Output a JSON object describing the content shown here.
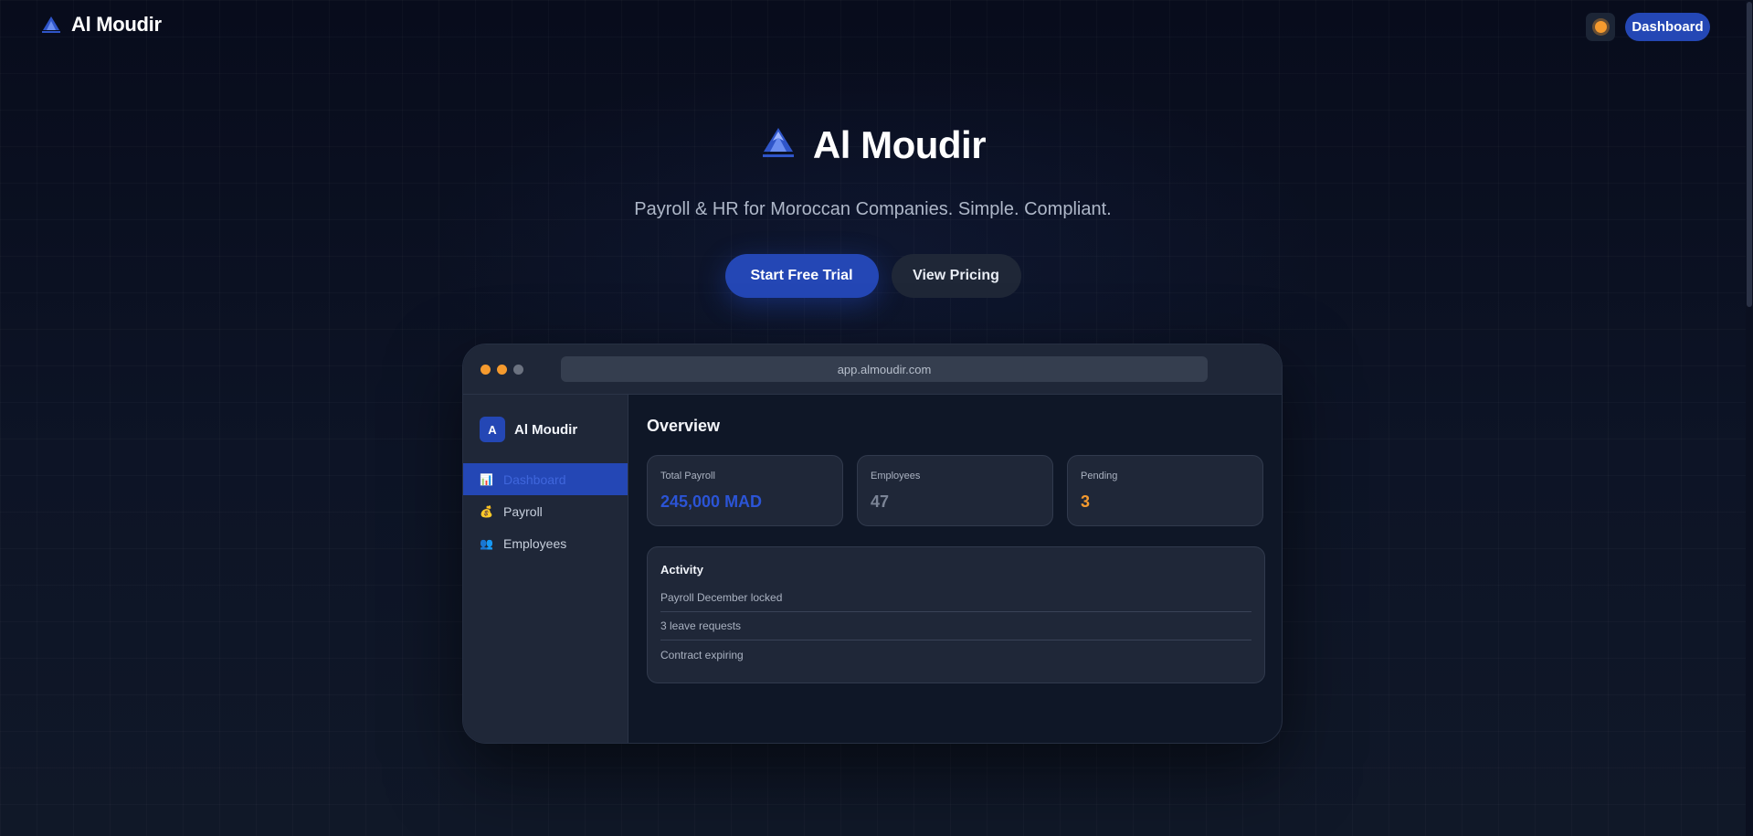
{
  "nav": {
    "brand": "Al Moudir",
    "theme_icon": "sun-icon",
    "dashboard_label": "Dashboard"
  },
  "hero": {
    "title": "Al Moudir",
    "tagline": "Payroll & HR for Moroccan Companies. Simple. Compliant.",
    "primary_cta": "Start Free Trial",
    "secondary_cta": "View Pricing"
  },
  "preview": {
    "url": "app.almoudir.com",
    "window_dots": [
      "#f59a2e",
      "#f59a2e",
      "#6b7280"
    ],
    "sidebar": {
      "logo_letter": "A",
      "brand": "Al Moudir",
      "items": [
        {
          "icon": "chart-icon",
          "glyph": "📊",
          "label": "Dashboard",
          "active": true
        },
        {
          "icon": "money-bag-icon",
          "glyph": "💰",
          "label": "Payroll",
          "active": false
        },
        {
          "icon": "people-icon",
          "glyph": "👥",
          "label": "Employees",
          "active": false
        }
      ]
    },
    "main": {
      "title": "Overview",
      "stats": [
        {
          "label": "Total Payroll",
          "value": "245,000 MAD",
          "color": "#2b54d6"
        },
        {
          "label": "Employees",
          "value": "47",
          "color": "#7b8496"
        },
        {
          "label": "Pending",
          "value": "3",
          "color": "#f59a2e"
        }
      ],
      "activity": {
        "title": "Activity",
        "items": [
          "Payroll December locked",
          "3 leave requests",
          "Contract expiring"
        ]
      }
    }
  },
  "colors": {
    "accent": "#2447b5",
    "background": "#0b1020",
    "warning": "#f59a2e"
  }
}
